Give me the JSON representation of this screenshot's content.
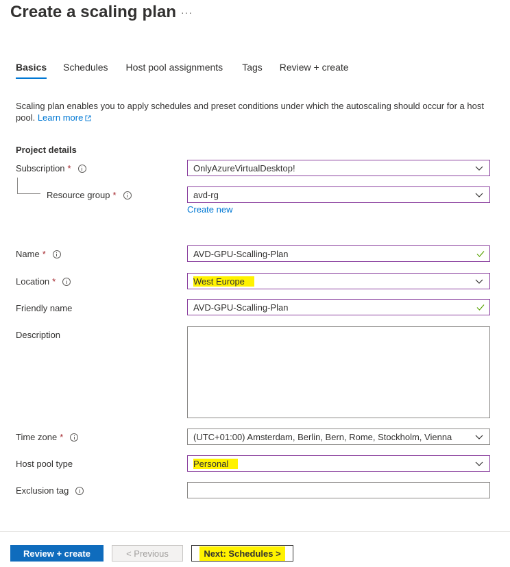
{
  "header": {
    "title": "Create a scaling plan",
    "more": "···"
  },
  "tabs": [
    "Basics",
    "Schedules",
    "Host pool assignments",
    "Tags",
    "Review + create"
  ],
  "intro": {
    "text": "Scaling plan enables you to apply schedules and preset conditions under which the autoscaling should occur for a host pool.",
    "link": "Learn more"
  },
  "project_details": {
    "heading": "Project details",
    "subscription_label": "Subscription",
    "subscription_value": "OnlyAzureVirtualDesktop!",
    "resource_group_label": "Resource group",
    "resource_group_value": "avd-rg",
    "create_new": "Create new"
  },
  "form": {
    "required_mark": "*",
    "name_label": "Name",
    "name_value": "AVD-GPU-Scalling-Plan",
    "location_label": "Location",
    "location_value": "West Europe",
    "friendly_label": "Friendly name",
    "friendly_value": "AVD-GPU-Scalling-Plan",
    "description_label": "Description",
    "timezone_label": "Time zone",
    "timezone_value": "(UTC+01:00) Amsterdam, Berlin, Bern, Rome, Stockholm, Vienna",
    "hostpool_label": "Host pool type",
    "hostpool_value": "Personal",
    "exclusion_label": "Exclusion tag",
    "exclusion_value": ""
  },
  "footer": {
    "review": "Review + create",
    "previous": "< Previous",
    "next": "Next: Schedules >"
  },
  "colors": {
    "accent": "#0078d4",
    "primary_button": "#0f6cbd",
    "required": "#a4262c",
    "valid_check": "#57a300",
    "highlight": "#fff200",
    "focus_border": "#8a3f9e"
  },
  "icons": [
    "more-icon",
    "external-link-icon",
    "info-icon",
    "chevron-down-icon",
    "checkmark-icon"
  ]
}
